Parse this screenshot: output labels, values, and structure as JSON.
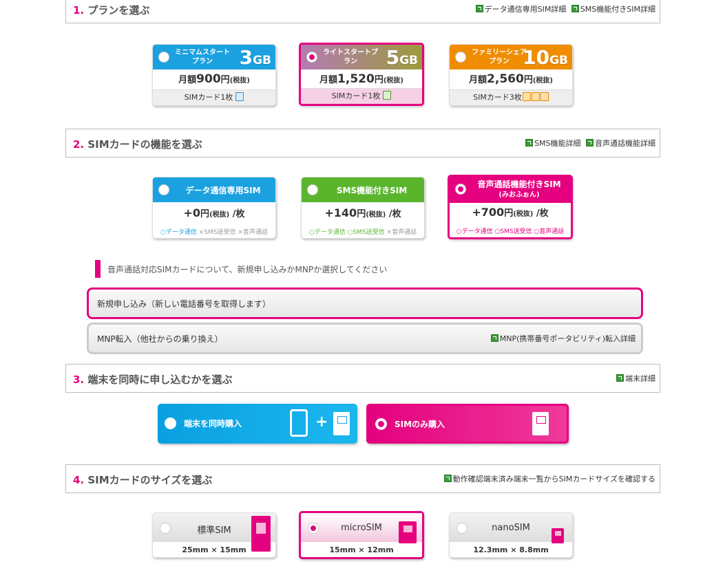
{
  "sections": {
    "plan": {
      "num": "1.",
      "title": "プランを選ぶ",
      "links": [
        "データ通信専用SIM詳細",
        "SMS機能付きSIM詳細"
      ]
    },
    "function": {
      "num": "2.",
      "title": "SIMカードの機能を選ぶ",
      "links": [
        "SMS機能詳細",
        "音声通話機能詳細"
      ]
    },
    "device": {
      "num": "3.",
      "title": "端末を同時に申し込むかを選ぶ",
      "links": [
        "端末詳細"
      ]
    },
    "size": {
      "num": "4.",
      "title": "SIMカードのサイズを選ぶ",
      "links": [
        "動作確認端末済み端末一覧からSIMカードサイズを確認する"
      ]
    }
  },
  "plans": [
    {
      "name": "ミニマムスタートプラン",
      "gb": "3",
      "unit": "GB",
      "price_prefix": "月額",
      "price": "900",
      "price_unit": "円",
      "tax": "(税抜)",
      "sim": "SIMカード1枚",
      "color": "#1ba1e0",
      "selected": false
    },
    {
      "name": "ライトスタートプラン",
      "gb": "5",
      "unit": "GB",
      "price_prefix": "月額",
      "price": "1,520",
      "price_unit": "円",
      "tax": "(税抜)",
      "sim": "SIMカード1枚",
      "color": "#a36aa3",
      "selected": true
    },
    {
      "name": "ファミリーシェアプラン",
      "gb": "10",
      "unit": "GB",
      "price_prefix": "月額",
      "price": "2,560",
      "price_unit": "円",
      "tax": "(税抜)",
      "sim": "SIMカード3枚",
      "color": "#f08c00",
      "selected": false
    }
  ],
  "functions": [
    {
      "title": "データ通信専用SIM",
      "sub": "",
      "price": "+0",
      "price_unit": "円",
      "tax": "(税抜)",
      "per": "/枚",
      "features": [
        "○データ通信",
        "×SMS送受信",
        "×音声通話"
      ],
      "color": "#1ba1e0",
      "selected": false
    },
    {
      "title": "SMS機能付きSIM",
      "sub": "",
      "price": "+140",
      "price_unit": "円",
      "tax": "(税抜)",
      "per": "/枚",
      "features": [
        "○データ通信",
        "○SMS送受信",
        "×音声通話"
      ],
      "color": "#5ab52d",
      "selected": false
    },
    {
      "title": "音声通話機能付きSIM",
      "sub": "(みおふぉん)",
      "price": "+700",
      "price_unit": "円",
      "tax": "(税抜)",
      "per": "/枚",
      "features": [
        "○データ通信",
        "○SMS送受信",
        "○音声通話"
      ],
      "color": "#e4007f",
      "selected": true
    }
  ],
  "notice": "音声通話対応SIMカードについて、新規申し込みかMNPか選択してください",
  "options": {
    "new": "新規申し込み（新しい電話番号を取得します）",
    "mnp": "MNP転入（他社からの乗り換え）",
    "mnp_link": "MNP(携帯番号ポータビリティ)転入詳細"
  },
  "device": {
    "with_device": "端末を同時購入",
    "sim_only": "SIMのみ購入",
    "plus": "+"
  },
  "sizes": [
    {
      "name": "標準SIM",
      "dims": "25mm × 15mm",
      "selected": false
    },
    {
      "name": "microSIM",
      "dims": "15mm × 12mm",
      "selected": true
    },
    {
      "name": "nanoSIM",
      "dims": "12.3mm × 8.8mm",
      "selected": false
    }
  ]
}
